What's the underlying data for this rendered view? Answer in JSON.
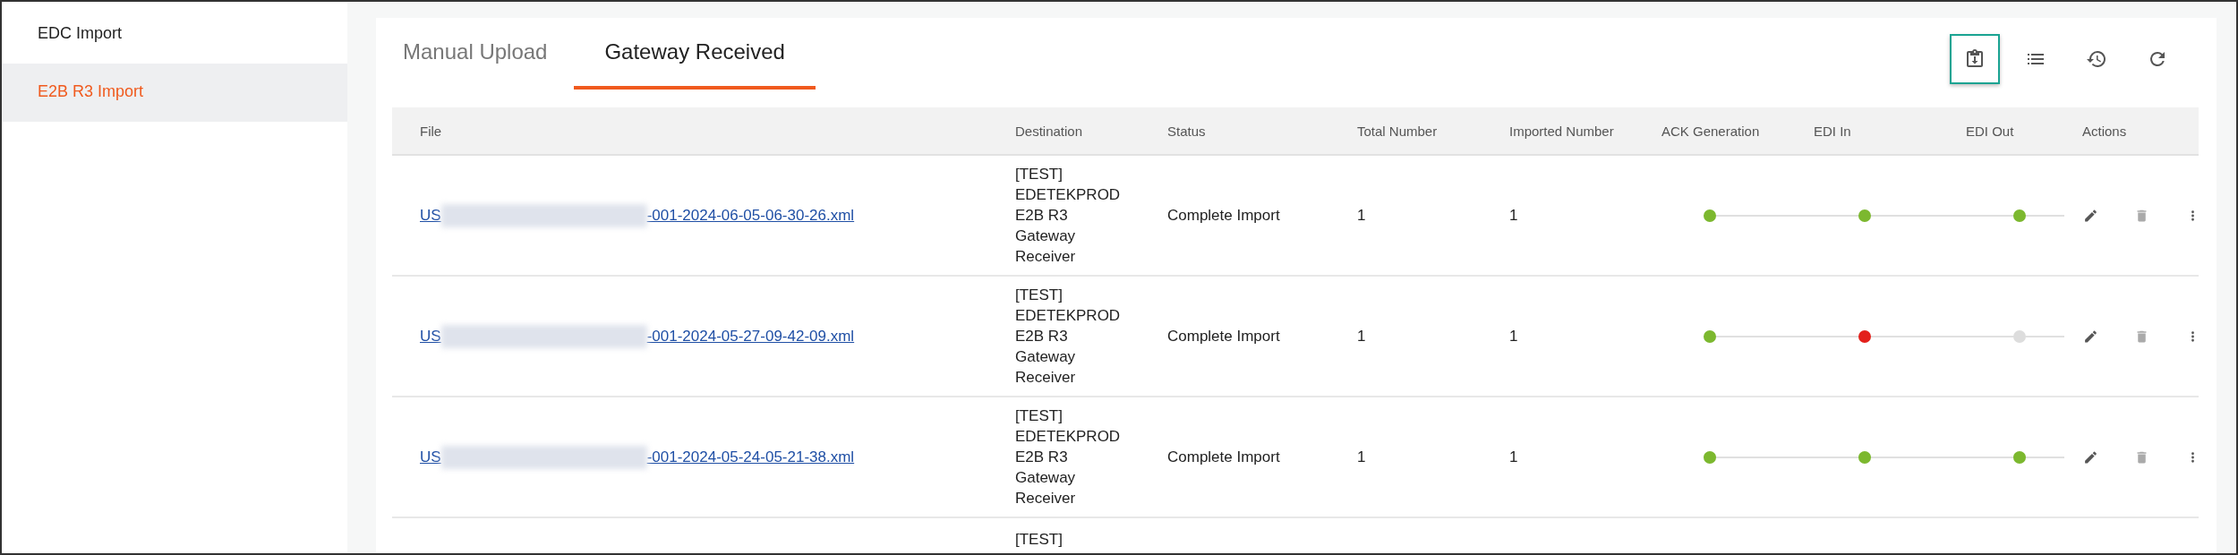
{
  "sidebar": {
    "items": [
      {
        "label": "EDC Import",
        "selected": false
      },
      {
        "label": "E2B R3 Import",
        "selected": true
      }
    ]
  },
  "tabs": [
    {
      "label": "Manual Upload",
      "selected": false
    },
    {
      "label": "Gateway Received",
      "selected": true
    }
  ],
  "toolbar": [
    {
      "kind": "clipboard",
      "selected": true
    },
    {
      "kind": "list",
      "selected": false
    },
    {
      "kind": "history",
      "selected": false
    },
    {
      "kind": "refresh",
      "selected": false
    }
  ],
  "table": {
    "columns": [
      "File",
      "Destination",
      "Status",
      "Total Number",
      "Imported Number",
      "ACK Generation",
      "EDI In",
      "EDI Out",
      "Actions"
    ],
    "rows": [
      {
        "file_prefix": "US",
        "file_suffix": "-001-2024-06-05-06-30-26.xml",
        "destination": [
          "[TEST]",
          "EDETEKPROD",
          "E2B R3",
          "Gateway",
          "Receiver"
        ],
        "status": "Complete Import",
        "total": "1",
        "imported": "1",
        "steps": [
          {
            "color": "#7cb82f"
          },
          {
            "color": "#7cb82f"
          },
          {
            "color": "#7cb82f"
          }
        ]
      },
      {
        "file_prefix": "US",
        "file_suffix": "-001-2024-05-27-09-42-09.xml",
        "destination": [
          "[TEST]",
          "EDETEKPROD",
          "E2B R3",
          "Gateway",
          "Receiver"
        ],
        "status": "Complete Import",
        "total": "1",
        "imported": "1",
        "steps": [
          {
            "color": "#7cb82f"
          },
          {
            "color": "#e3201b"
          },
          {
            "color": "#dddddd"
          }
        ]
      },
      {
        "file_prefix": "US",
        "file_suffix": "-001-2024-05-24-05-21-38.xml",
        "destination": [
          "[TEST]",
          "EDETEKPROD",
          "E2B R3",
          "Gateway",
          "Receiver"
        ],
        "status": "Complete Import",
        "total": "1",
        "imported": "1",
        "steps": [
          {
            "color": "#7cb82f"
          },
          {
            "color": "#7cb82f"
          },
          {
            "color": "#7cb82f"
          }
        ]
      }
    ],
    "partial_row": {
      "destination": [
        "[TEST]"
      ]
    }
  }
}
